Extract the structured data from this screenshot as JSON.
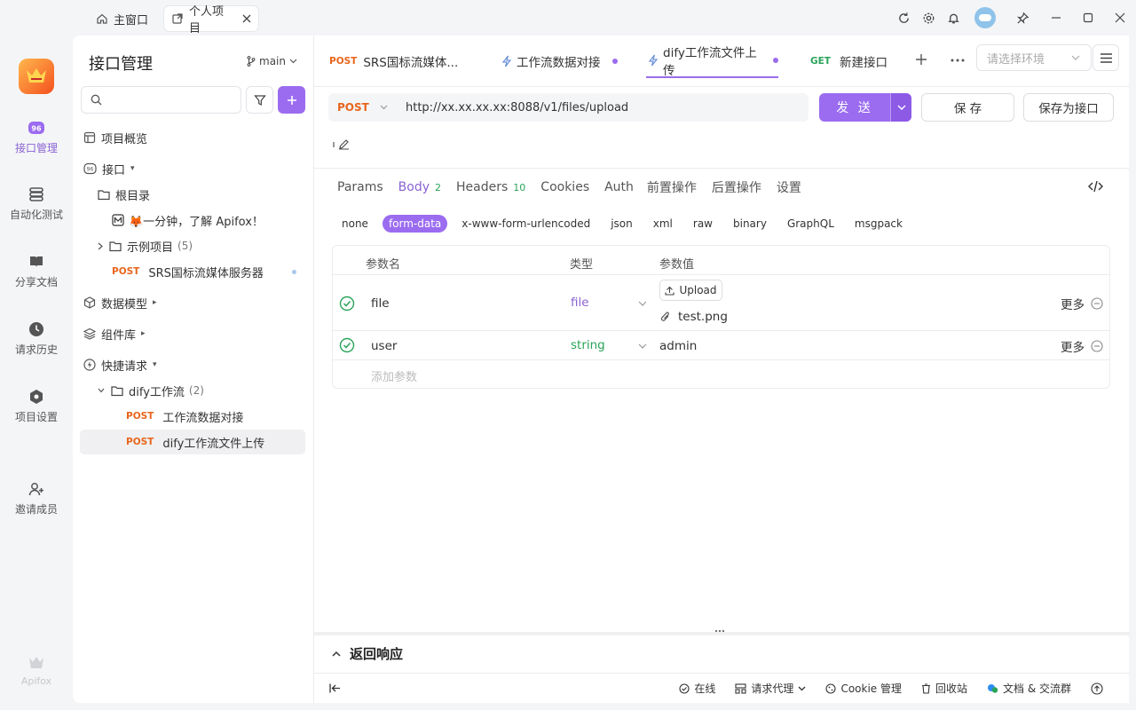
{
  "window": {
    "tabs": [
      {
        "label": "主窗口"
      },
      {
        "label": "个人项目"
      }
    ]
  },
  "rail": {
    "items": [
      {
        "label": "接口管理",
        "icon": "api-icon"
      },
      {
        "label": "自动化测试",
        "icon": "automation-icon"
      },
      {
        "label": "分享文档",
        "icon": "book-icon"
      },
      {
        "label": "请求历史",
        "icon": "history-icon"
      },
      {
        "label": "项目设置",
        "icon": "settings-icon"
      },
      {
        "label": "邀请成员",
        "icon": "invite-user-icon"
      }
    ],
    "brand": "Apifox"
  },
  "sidebar": {
    "title": "接口管理",
    "branch": "main",
    "search_placeholder": "",
    "tree": {
      "overview": "项目概览",
      "apis": "接口",
      "root": "根目录",
      "doc": "🦊一分钟，了解 Apifox！",
      "examples": "示例项目",
      "examples_count": "(5)",
      "srs_method": "POST",
      "srs": "SRS国标流媒体服务器",
      "models": "数据模型",
      "components": "组件库",
      "quick": "快捷请求",
      "dify_folder": "dify工作流",
      "dify_count": "(2)",
      "item1_method": "POST",
      "item1": "工作流数据对接",
      "item2_method": "POST",
      "item2": "dify工作流文件上传"
    }
  },
  "main": {
    "tabs": [
      {
        "method": "POST",
        "label": "SRS国标流媒体..."
      },
      {
        "label": "工作流数据对接"
      },
      {
        "label": "dify工作流文件上传"
      },
      {
        "method": "GET",
        "label": "新建接口"
      }
    ],
    "env_placeholder": "请选择环境",
    "request": {
      "method": "POST",
      "url": "http://xx.xx.xx.xx:8088/v1/files/upload",
      "send": "发 送",
      "save": "保 存",
      "save_as": "保存为接口"
    },
    "subtabs": {
      "params": "Params",
      "body": "Body",
      "body_count": "2",
      "headers": "Headers",
      "headers_count": "10",
      "cookies": "Cookies",
      "auth": "Auth",
      "pre": "前置操作",
      "post": "后置操作",
      "settings": "设置"
    },
    "body_types": [
      "none",
      "form-data",
      "x-www-form-urlencoded",
      "json",
      "xml",
      "raw",
      "binary",
      "GraphQL",
      "msgpack"
    ],
    "params_table": {
      "headers": {
        "name": "参数名",
        "type": "类型",
        "value": "参数值"
      },
      "rows": [
        {
          "name": "file",
          "type": "file",
          "upload": "Upload",
          "value": "test.png",
          "more": "更多"
        },
        {
          "name": "user",
          "type": "string",
          "value": "admin",
          "more": "更多"
        }
      ],
      "add_placeholder": "添加参数"
    },
    "response": {
      "title": "返回响应"
    },
    "status": {
      "online": "在线",
      "proxy": "请求代理",
      "cookie": "Cookie 管理",
      "trash": "回收站",
      "docs": "文档 & 交流群"
    }
  },
  "colors": {
    "accent": "#9b6cf0",
    "post": "#e8651c",
    "get": "#2aa35a"
  }
}
